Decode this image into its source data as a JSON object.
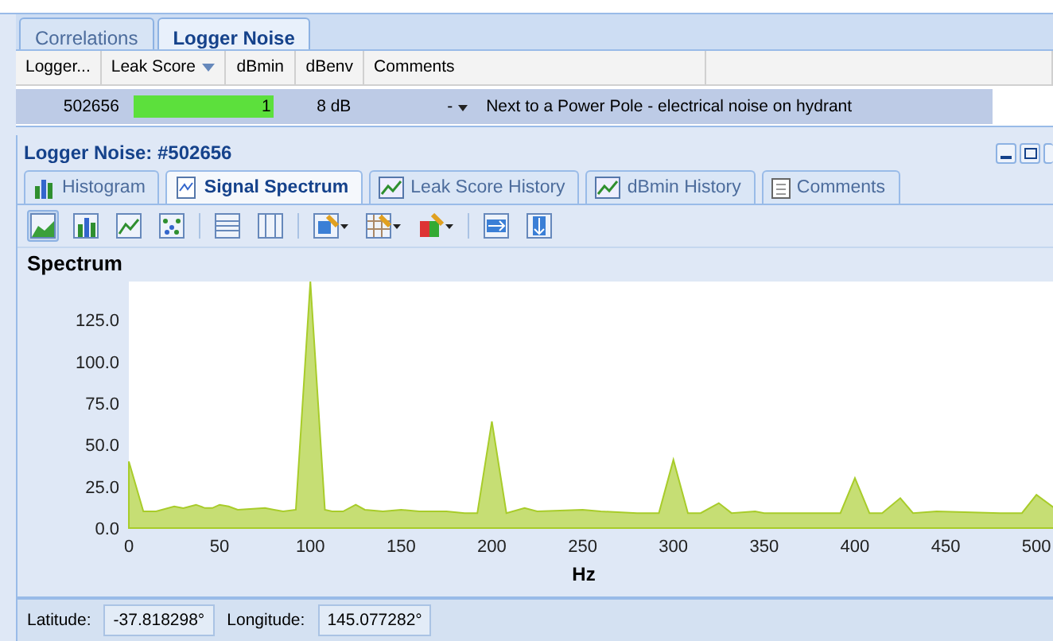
{
  "top_tabs": [
    {
      "label": "Correlations",
      "selected": false
    },
    {
      "label": "Logger Noise",
      "selected": true
    }
  ],
  "grid": {
    "columns": [
      {
        "label": "Logger...",
        "sorted": false
      },
      {
        "label": "Leak Score",
        "sorted": true
      },
      {
        "label": "dBmin",
        "sorted": false
      },
      {
        "label": "dBenv",
        "sorted": false
      },
      {
        "label": "Comments",
        "sorted": false
      }
    ],
    "rows": [
      {
        "logger": "502656",
        "leak_score": "1",
        "level": 1,
        "dbmin": "8 dB",
        "dbenv": "-",
        "comments": "Next to a Power Pole - electrical noise on hydrant",
        "selected": true
      }
    ]
  },
  "panel": {
    "title": "Logger Noise: #502656",
    "tabs": [
      {
        "label": "Histogram",
        "kind": "bars",
        "selected": false
      },
      {
        "label": "Signal Spectrum",
        "kind": "spectrum",
        "selected": true
      },
      {
        "label": "Leak Score History",
        "kind": "line",
        "selected": false
      },
      {
        "label": "dBmin History",
        "kind": "line",
        "selected": false
      },
      {
        "label": "Comments",
        "kind": "notes",
        "selected": false
      }
    ],
    "toolbar": [
      {
        "kind": "area",
        "selected": true
      },
      {
        "kind": "bars",
        "selected": false
      },
      {
        "kind": "line",
        "selected": false
      },
      {
        "kind": "scatter",
        "selected": false
      },
      {
        "kind": "sep"
      },
      {
        "kind": "rows",
        "selected": false
      },
      {
        "kind": "cols",
        "selected": false
      },
      {
        "kind": "sep"
      },
      {
        "kind": "palette",
        "selected": false,
        "dropdown": true
      },
      {
        "kind": "grid",
        "selected": false,
        "dropdown": true
      },
      {
        "kind": "color",
        "selected": false,
        "dropdown": true
      },
      {
        "kind": "sep"
      },
      {
        "kind": "fit-h",
        "selected": false
      },
      {
        "kind": "fit-v",
        "selected": false
      }
    ],
    "chart_title": "Spectrum",
    "chart_data": {
      "type": "area",
      "xlabel": "Hz",
      "xlim": [
        0,
        510
      ],
      "ylim": [
        0,
        148
      ],
      "xticks": [
        0,
        50,
        100,
        150,
        200,
        250,
        300,
        350,
        400,
        450,
        500
      ],
      "yticks": [
        {
          "value": 0,
          "label": "0.0"
        },
        {
          "value": 25,
          "label": "25.0"
        },
        {
          "value": 50,
          "label": "50.0"
        },
        {
          "value": 75,
          "label": "75.0"
        },
        {
          "value": 100,
          "label": "100.0"
        },
        {
          "value": 125,
          "label": "125.0"
        }
      ],
      "x": [
        0,
        8,
        15,
        25,
        30,
        37,
        42,
        46,
        50,
        55,
        60,
        75,
        80,
        85,
        92,
        100,
        108,
        112,
        118,
        125,
        130,
        140,
        150,
        160,
        175,
        185,
        192,
        200,
        208,
        218,
        225,
        250,
        260,
        280,
        292,
        300,
        308,
        315,
        325,
        332,
        345,
        350,
        380,
        392,
        400,
        408,
        415,
        425,
        432,
        445,
        480,
        492,
        500,
        510
      ],
      "series": [
        {
          "color": "#a8cc2a",
          "values": [
            40,
            10,
            10,
            13,
            12,
            14,
            12,
            12,
            14,
            13,
            11,
            12,
            11,
            10,
            11,
            148,
            11,
            10,
            10,
            14,
            11,
            10,
            11,
            10,
            10,
            9,
            9,
            64,
            9,
            12,
            10,
            11,
            10,
            9,
            9,
            41,
            9,
            9,
            15,
            9,
            10,
            9,
            9,
            9,
            30,
            9,
            9,
            18,
            9,
            10,
            9,
            9,
            20,
            12
          ]
        }
      ]
    },
    "status": [
      {
        "label": "Latitude:",
        "value": "-37.818298°"
      },
      {
        "label": "Longitude:",
        "value": "145.077282°"
      }
    ]
  }
}
